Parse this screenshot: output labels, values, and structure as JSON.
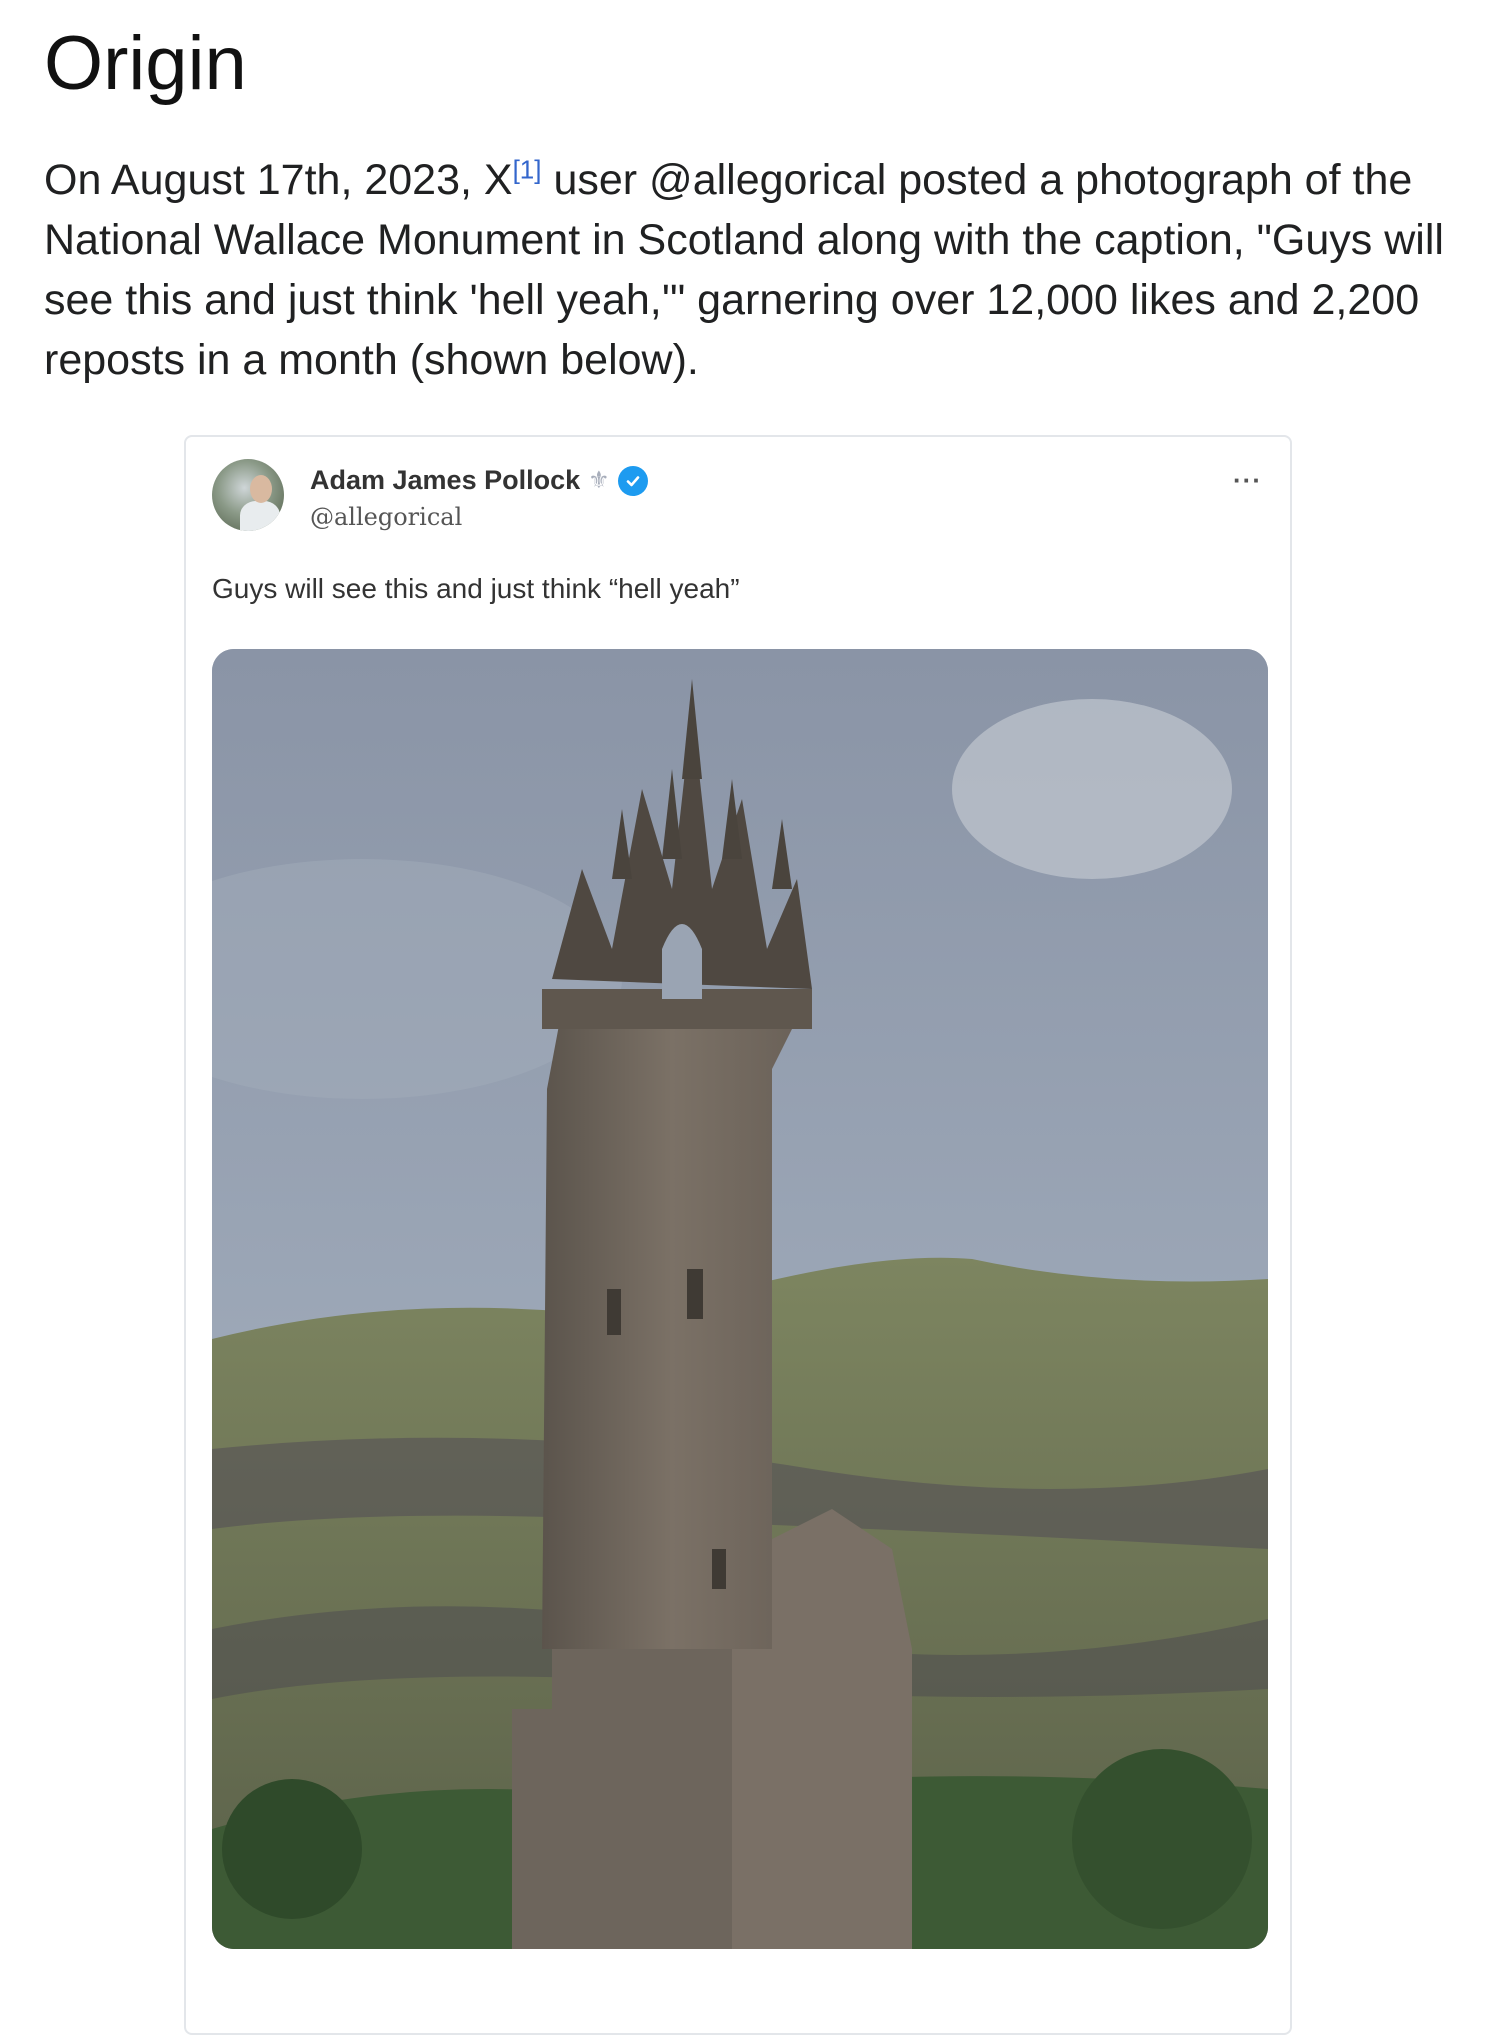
{
  "section": {
    "heading": "Origin"
  },
  "paragraph": {
    "part1": "On August 17th, 2023, X",
    "citation": "[1]",
    "part2": " user @allegorical posted a photograph of the National Wallace Monument in Scotland along with the caption, \"Guys will see this and just think 'hell yeah,'\" garnering over 12,000 likes and 2,200 reposts in a month (shown below)."
  },
  "tweet": {
    "display_name": "Adam James Pollock",
    "name_emoji": "⚜",
    "handle": "@allegorical",
    "text": "Guys will see this and just think “hell yeah”",
    "more_label": "···",
    "media_icon": "tower-photo",
    "verified_color": "#1d9bf0"
  }
}
